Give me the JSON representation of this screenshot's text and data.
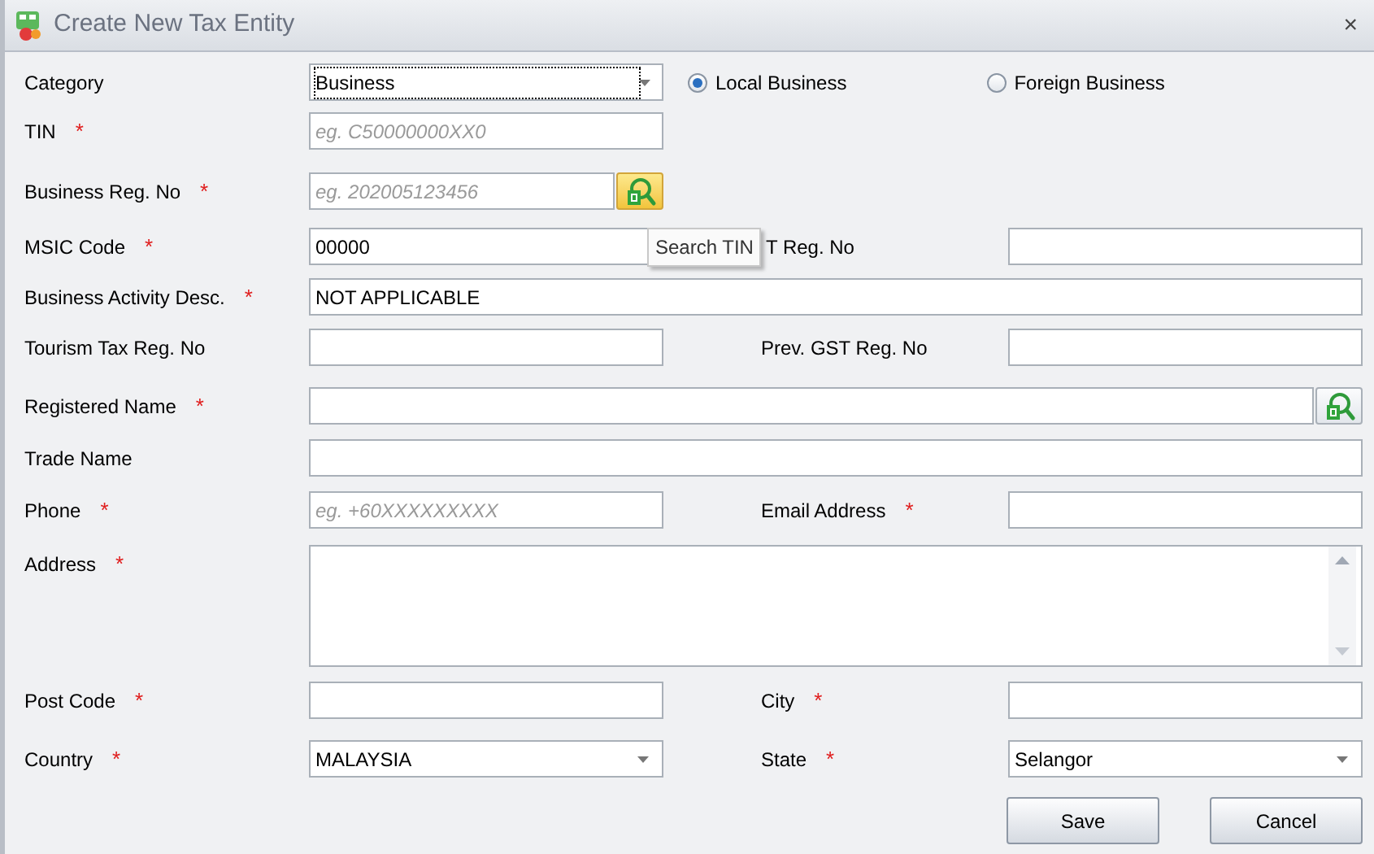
{
  "window": {
    "title": "Create New Tax Entity",
    "close": "×"
  },
  "rows": [
    {
      "kind": "category",
      "left": {
        "label": "Category",
        "field": {
          "kind": "select",
          "value": "Business",
          "focused": true
        }
      },
      "options": [
        {
          "label": "Local Business",
          "selected": true
        },
        {
          "label": "Foreign Business",
          "selected": false
        }
      ]
    },
    {
      "kind": "pair",
      "left": {
        "label": "TIN",
        "marker": "*",
        "field": {
          "kind": "text",
          "placeholder": "eg. C50000000XX0"
        }
      }
    },
    {
      "kind": "pair",
      "left": {
        "label": "Business Reg. No",
        "marker": "*",
        "field": {
          "kind": "text",
          "placeholder": "eg. 202005123456",
          "lookup": {
            "hovered": true,
            "tooltip": "Search TIN"
          }
        }
      }
    },
    {
      "kind": "pair",
      "left": {
        "label": "MSIC Code",
        "marker": "*",
        "field": {
          "kind": "text",
          "value": "00000"
        }
      },
      "right": {
        "label": "T Reg. No",
        "field": {
          "kind": "text"
        }
      }
    },
    {
      "kind": "wide",
      "left": {
        "label": "Business Activity Desc.",
        "marker": "*",
        "field": {
          "kind": "text",
          "value": "NOT APPLICABLE"
        }
      }
    },
    {
      "kind": "pair",
      "left": {
        "label": "Tourism Tax Reg. No",
        "field": {
          "kind": "text"
        }
      },
      "right": {
        "label": "Prev. GST Reg. No",
        "field": {
          "kind": "text"
        }
      }
    },
    {
      "kind": "wide",
      "left": {
        "label": "Registered Name",
        "marker": "*",
        "field": {
          "kind": "text",
          "lookup": {
            "hovered": false
          }
        }
      }
    },
    {
      "kind": "wide",
      "left": {
        "label": "Trade Name",
        "field": {
          "kind": "text"
        }
      }
    },
    {
      "kind": "pair",
      "left": {
        "label": "Phone",
        "marker": "*",
        "field": {
          "kind": "text",
          "placeholder": "eg. +60XXXXXXXXX"
        }
      },
      "right": {
        "label": "Email Address",
        "marker": "*",
        "field": {
          "kind": "text"
        }
      }
    },
    {
      "kind": "wide",
      "left": {
        "label": "Address",
        "marker": "*",
        "field": {
          "kind": "textarea"
        }
      }
    },
    {
      "kind": "pair",
      "left": {
        "label": "Post Code",
        "marker": "*",
        "field": {
          "kind": "text"
        }
      },
      "right": {
        "label": "City",
        "marker": "*",
        "field": {
          "kind": "text"
        }
      }
    },
    {
      "kind": "pair",
      "left": {
        "label": "Country",
        "marker": "*",
        "field": {
          "kind": "select",
          "value": "MALAYSIA"
        }
      },
      "right": {
        "label": "State",
        "marker": "*",
        "field": {
          "kind": "select",
          "value": "Selangor"
        }
      }
    }
  ],
  "buttons": [
    "Save",
    "Cancel"
  ]
}
